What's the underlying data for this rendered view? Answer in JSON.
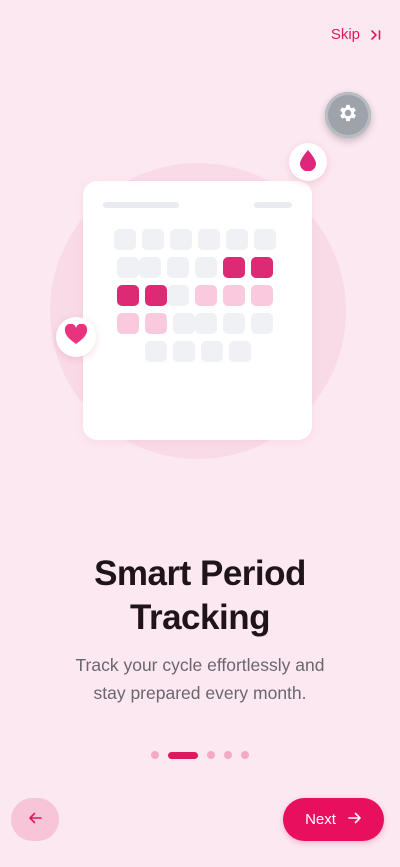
{
  "header": {
    "skip_label": "Skip"
  },
  "onboarding": {
    "title_line1": "Smart Period",
    "title_line2": "Tracking",
    "subtitle_line1": "Track your cycle effortlessly and",
    "subtitle_line2": "stay prepared every month.",
    "page_count": 5,
    "active_page": 2
  },
  "footer": {
    "next_label": "Next"
  },
  "colors": {
    "background": "#fce8f1",
    "accent": "#e0185f",
    "cell_empty": "#eff1f5",
    "cell_period": "#dc2b74",
    "cell_predicted": "#f9cadd"
  }
}
